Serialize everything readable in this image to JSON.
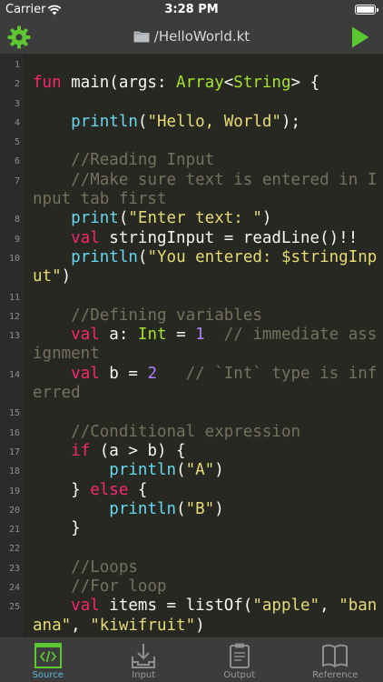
{
  "status_bar": {
    "carrier": "Carrier",
    "time": "3:28 PM"
  },
  "nav": {
    "title": "/HelloWorld.kt"
  },
  "editor": {
    "lines": [
      {
        "n": "1",
        "t": []
      },
      {
        "n": "2",
        "t": [
          [
            "kw",
            "fun"
          ],
          [
            "",
            " main(args: "
          ],
          [
            "type",
            "Array"
          ],
          [
            "",
            "<"
          ],
          [
            "type",
            "String"
          ],
          [
            "",
            "> {"
          ]
        ]
      },
      {
        "n": "3",
        "t": []
      },
      {
        "n": "4",
        "t": [
          [
            "",
            "    "
          ],
          [
            "call",
            "println"
          ],
          [
            "",
            "("
          ],
          [
            "str",
            "\"Hello, World\""
          ],
          [
            "",
            ");"
          ]
        ]
      },
      {
        "n": "5",
        "t": []
      },
      {
        "n": "6",
        "t": [
          [
            "",
            "    "
          ],
          [
            "cm",
            "//Reading Input"
          ]
        ]
      },
      {
        "n": "7",
        "t": [
          [
            "",
            "    "
          ],
          [
            "cm",
            "//Make sure text is entered in Input tab first"
          ]
        ]
      },
      {
        "n": "8",
        "t": [
          [
            "",
            "    "
          ],
          [
            "call",
            "print"
          ],
          [
            "",
            "("
          ],
          [
            "str",
            "\"Enter text: \""
          ],
          [
            "",
            ")"
          ]
        ]
      },
      {
        "n": "9",
        "t": [
          [
            "",
            "    "
          ],
          [
            "kw",
            "val"
          ],
          [
            "",
            " stringInput = readLine()!!"
          ]
        ]
      },
      {
        "n": "10",
        "t": [
          [
            "",
            "    "
          ],
          [
            "call",
            "println"
          ],
          [
            "",
            "("
          ],
          [
            "str",
            "\"You entered: $stringInput\""
          ],
          [
            "",
            ")"
          ]
        ]
      },
      {
        "n": "11",
        "t": []
      },
      {
        "n": "12",
        "t": [
          [
            "",
            "    "
          ],
          [
            "cm",
            "//Defining variables"
          ]
        ]
      },
      {
        "n": "13",
        "t": [
          [
            "",
            "    "
          ],
          [
            "kw",
            "val"
          ],
          [
            "",
            " a: "
          ],
          [
            "type",
            "Int"
          ],
          [
            "",
            " = "
          ],
          [
            "num",
            "1"
          ],
          [
            "",
            "  "
          ],
          [
            "cm",
            "// immediate assignment"
          ]
        ]
      },
      {
        "n": "14",
        "t": [
          [
            "",
            "    "
          ],
          [
            "kw",
            "val"
          ],
          [
            "",
            " b = "
          ],
          [
            "num",
            "2"
          ],
          [
            "",
            "   "
          ],
          [
            "cm",
            "// `Int` type is inferred"
          ]
        ]
      },
      {
        "n": "15",
        "t": []
      },
      {
        "n": "16",
        "t": [
          [
            "",
            "    "
          ],
          [
            "cm",
            "//Conditional expression"
          ]
        ]
      },
      {
        "n": "17",
        "t": [
          [
            "",
            "    "
          ],
          [
            "kw",
            "if"
          ],
          [
            "",
            " (a > b) {"
          ]
        ]
      },
      {
        "n": "18",
        "t": [
          [
            "",
            "        "
          ],
          [
            "call",
            "println"
          ],
          [
            "",
            "("
          ],
          [
            "str",
            "\"A\""
          ],
          [
            "",
            ")"
          ]
        ]
      },
      {
        "n": "19",
        "t": [
          [
            "",
            "    } "
          ],
          [
            "kw",
            "else"
          ],
          [
            "",
            " {"
          ]
        ]
      },
      {
        "n": "20",
        "t": [
          [
            "",
            "        "
          ],
          [
            "call",
            "println"
          ],
          [
            "",
            "("
          ],
          [
            "str",
            "\"B\""
          ],
          [
            "",
            ")"
          ]
        ]
      },
      {
        "n": "21",
        "t": [
          [
            "",
            "    }"
          ]
        ]
      },
      {
        "n": "22",
        "t": []
      },
      {
        "n": "23",
        "t": [
          [
            "",
            "    "
          ],
          [
            "cm",
            "//Loops"
          ]
        ]
      },
      {
        "n": "24",
        "t": [
          [
            "",
            "    "
          ],
          [
            "cm",
            "//For loop"
          ]
        ]
      },
      {
        "n": "25",
        "t": [
          [
            "",
            "    "
          ],
          [
            "kw",
            "val"
          ],
          [
            "",
            " items = listOf("
          ],
          [
            "str",
            "\"apple\""
          ],
          [
            "",
            ", "
          ],
          [
            "str",
            "\"banana\""
          ],
          [
            "",
            ", "
          ],
          [
            "str",
            "\"kiwifruit\""
          ],
          [
            "",
            ")"
          ]
        ]
      }
    ]
  },
  "tabs": [
    {
      "label": "Source",
      "icon": "code-icon",
      "active": true
    },
    {
      "label": "Input",
      "icon": "download-tray-icon",
      "active": false
    },
    {
      "label": "Output",
      "icon": "clipboard-icon",
      "active": false
    },
    {
      "label": "Reference",
      "icon": "book-icon",
      "active": false
    }
  ],
  "colors": {
    "accent_green": "#5cc531",
    "active_tab": "#5fb8d6",
    "editor_bg": "#272822",
    "bar_bg": "#3c3c3c",
    "keyword": "#f92672",
    "type": "#a6e22e",
    "function": "#66d9ef",
    "string": "#e6db74",
    "number": "#ae81ff",
    "comment": "#75715e"
  }
}
